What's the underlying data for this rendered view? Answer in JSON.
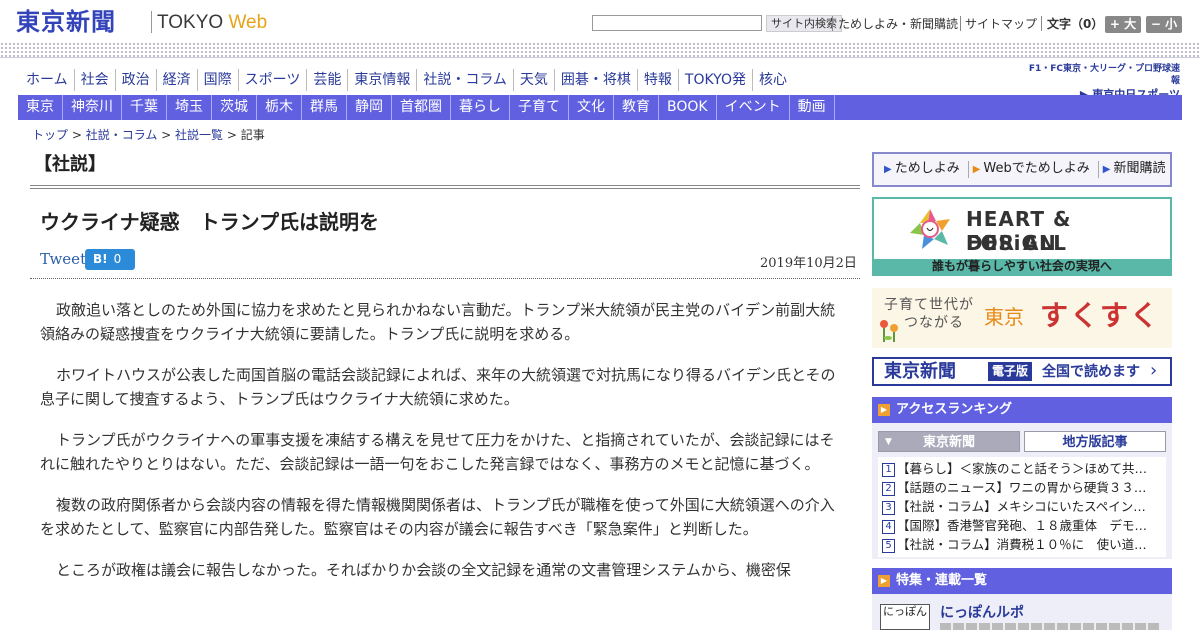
{
  "header": {
    "logo_jp": "東京新聞",
    "logo_tokyo": "TOKYO ",
    "logo_web": "Web",
    "search_placeholder": "",
    "search_button": "サイト内検索",
    "links": [
      "ためしよみ・新聞購読",
      "サイトマップ"
    ],
    "font_size_label": "文字（0）",
    "font_larger": "+ 大",
    "font_smaller": "− 小"
  },
  "nav_primary": [
    "ホーム",
    "社会",
    "政治",
    "経済",
    "国際",
    "スポーツ",
    "芸能",
    "東京情報",
    "社説・コラム",
    "天気",
    "囲碁・将棋",
    "特報",
    "TOKYO発",
    "核心"
  ],
  "chunichi": {
    "line1": "F1・FC東京・大リーグ・プロ野球速報",
    "line2": "▶ 東京中日スポーツ"
  },
  "nav_regional": [
    "東京",
    "神奈川",
    "千葉",
    "埼玉",
    "茨城",
    "栃木",
    "群馬",
    "静岡",
    "首都圏",
    "暮らし",
    "子育て",
    "文化",
    "教育",
    "BOOK",
    "イベント",
    "動画"
  ],
  "breadcrumb": {
    "items": [
      "トップ",
      "社説・コラム",
      "社説一覧"
    ],
    "separator": " > ",
    "current": "記事"
  },
  "article": {
    "section": "【社説】",
    "title": "ウクライナ疑惑　トランプ氏は説明を",
    "tweet_label": "Tweet",
    "hatena_label": "B!",
    "hatena_count": "0",
    "date": "2019年10月2日",
    "paragraphs": [
      "政敵追い落としのため外国に協力を求めたと見られかねない言動だ。トランプ米大統領が民主党のバイデン前副大統領絡みの疑惑捜査をウクライナ大統領に要請した。トランプ氏に説明を求める。",
      "ホワイトハウスが公表した両国首脳の電話会談記録によれば、来年の大統領選で対抗馬になり得るバイデン氏とその息子に関して捜査するよう、トランプ氏はウクライナ大統領に求めた。",
      "トランプ氏がウクライナへの軍事支援を凍結する構えを見せて圧力をかけた、と指摘されていたが、会談記録にはそれに触れたやりとりはない。ただ、会談記録は一語一句をおこした発言録ではなく、事務方のメモと記憶に基づく。",
      "複数の政府関係者から会談内容の情報を得た情報機関関係者は、トランプ氏が職権を使って外国に大統領選への介入を求めたとして、監察官に内部告発した。監察官はその内容が議会に報告すべき「緊急案件」と判断した。",
      "ところが政権は議会に報告しなかった。そればかりか会談の全文記録を通常の文書管理システムから、機密保"
    ]
  },
  "sidebar": {
    "tabs": [
      "ためしよみ",
      "Webでためしよみ",
      "新聞購読"
    ],
    "hd_title1": "HEART & DESiGN",
    "hd_title2": "FOR ALL",
    "hd_caption": "誰もが暮らしやすい社会の実現へ",
    "suku_line1": "子育て世代が",
    "suku_line2": "つながる",
    "suku_tokyo": "東京",
    "suku_main": "すくすく",
    "edenshi_logo": "東京新聞",
    "edenshi_badge": "電子版",
    "edenshi_text": "全国で読めます",
    "ranking_title": "アクセスランキング",
    "ranking_tab_a": "東京新聞",
    "ranking_tab_b": "地方版記事",
    "ranking_items": [
      {
        "num": "1",
        "text": "【暮らし】＜家族のこと話そう＞ほめて共…"
      },
      {
        "num": "2",
        "text": "【話題のニュース】ワニの胃から硬貨３３…"
      },
      {
        "num": "3",
        "text": "【社説・コラム】メキシコにいたスペイン…"
      },
      {
        "num": "4",
        "text": "【国際】香港警官発砲、１８歳重体　デモ…"
      },
      {
        "num": "5",
        "text": "【社説・コラム】消費税１０％に　使い道…"
      }
    ],
    "feature_title": "特集・連載一覧",
    "nippon_thumb": "にっぽん",
    "nippon_title": "にっぽんルポ"
  },
  "colors": {
    "brand_blue": "#3344bb",
    "nav_bar": "#6060e0",
    "web_orange": "#e8a317",
    "teal": "#5ab8a8"
  }
}
